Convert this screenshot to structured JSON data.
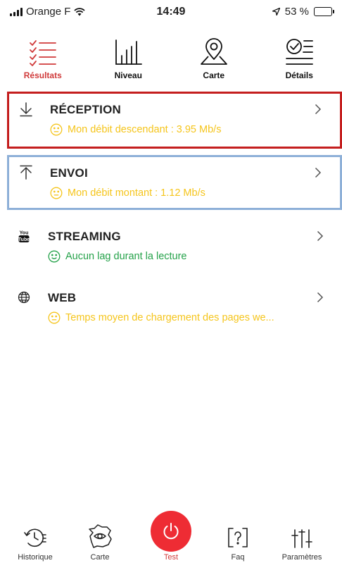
{
  "status_bar": {
    "carrier": "Orange F",
    "time": "14:49",
    "battery": "53 %",
    "battery_level": 0.53
  },
  "tabs": [
    {
      "label": "Résultats",
      "icon": "checklist-icon",
      "active": true
    },
    {
      "label": "Niveau",
      "icon": "bar-level-icon",
      "active": false
    },
    {
      "label": "Carte",
      "icon": "map-pin-icon",
      "active": false
    },
    {
      "label": "Détails",
      "icon": "details-check-icon",
      "active": false
    }
  ],
  "results": [
    {
      "title": "RÉCEPTION",
      "subtitle": "Mon débit descendant : 3.95 Mb/s",
      "icon": "download-arrow-icon",
      "status": "neutral",
      "color": "#f5c51c"
    },
    {
      "title": "ENVOI",
      "subtitle": "Mon débit montant : 1.12 Mb/s",
      "icon": "upload-arrow-icon",
      "status": "neutral",
      "color": "#f5c51c"
    },
    {
      "title": "STREAMING",
      "subtitle": "Aucun lag durant la lecture",
      "icon": "youtube-icon",
      "status": "good",
      "color": "#25a24a"
    },
    {
      "title": "WEB",
      "subtitle": "Temps moyen de chargement des pages we...",
      "icon": "globe-icon",
      "status": "neutral",
      "color": "#f5c51c"
    }
  ],
  "bottom_nav": [
    {
      "label": "Historique",
      "icon": "history-icon"
    },
    {
      "label": "Carte",
      "icon": "france-map-icon"
    },
    {
      "label": "Test",
      "icon": "power-icon"
    },
    {
      "label": "Faq",
      "icon": "faq-icon"
    },
    {
      "label": "Paramètres",
      "icon": "settings-sliders-icon"
    }
  ],
  "colors": {
    "accent": "#ee2c34",
    "active_tab": "#d03b3b",
    "highlight_red": "#c41e1e",
    "highlight_blue": "#8eb0d8"
  }
}
